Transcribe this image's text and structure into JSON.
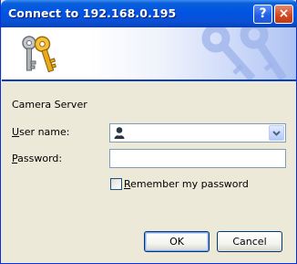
{
  "window": {
    "title": "Connect to 192.168.0.195",
    "help_glyph": "?",
    "close_glyph": "×"
  },
  "banner": {
    "icon": "keys-icon",
    "watermark": "keys-watermark-icon"
  },
  "form": {
    "realm": "Camera Server",
    "username": {
      "label_underlined": "U",
      "label_rest": "ser name:",
      "value": "",
      "icon": "user-icon"
    },
    "password": {
      "label_underlined": "P",
      "label_rest": "assword:",
      "value": ""
    },
    "remember": {
      "label_underlined": "R",
      "label_rest": "emember my password",
      "checked": false
    }
  },
  "buttons": {
    "ok": "OK",
    "cancel": "Cancel"
  },
  "colors": {
    "title_bar": "#0054e3",
    "dialog_bg": "#ece9d8",
    "field_border": "#7f9db9"
  }
}
